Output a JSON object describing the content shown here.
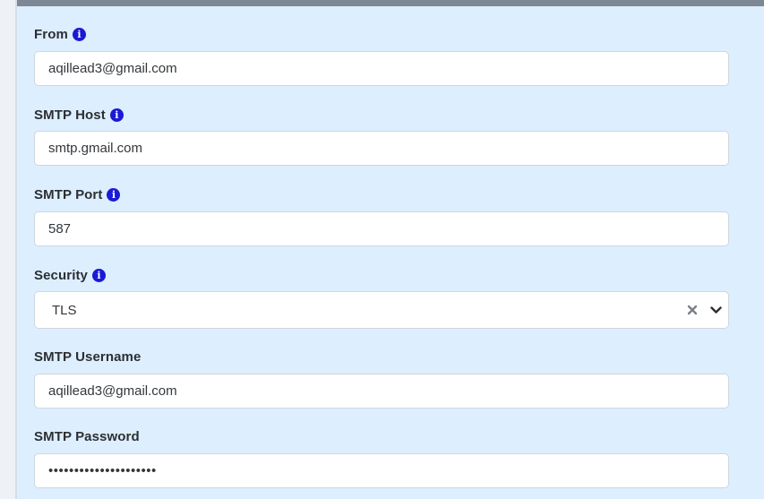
{
  "form": {
    "from": {
      "label": "From",
      "value": "aqillead3@gmail.com"
    },
    "smtp_host": {
      "label": "SMTP Host",
      "value": "smtp.gmail.com"
    },
    "smtp_port": {
      "label": "SMTP Port",
      "value": "587"
    },
    "security": {
      "label": "Security",
      "value": "TLS"
    },
    "smtp_username": {
      "label": "SMTP Username",
      "value": "aqillead3@gmail.com"
    },
    "smtp_password": {
      "label": "SMTP Password",
      "value": "•••••••••••••••••••••"
    }
  },
  "colors": {
    "info_icon": "#1a1ad6",
    "panel_background": "#ddeeff",
    "top_bar": "#7e8894"
  },
  "icons": {
    "info": "info-icon",
    "clear": "clear-icon",
    "dropdown": "chevron-down-icon"
  }
}
